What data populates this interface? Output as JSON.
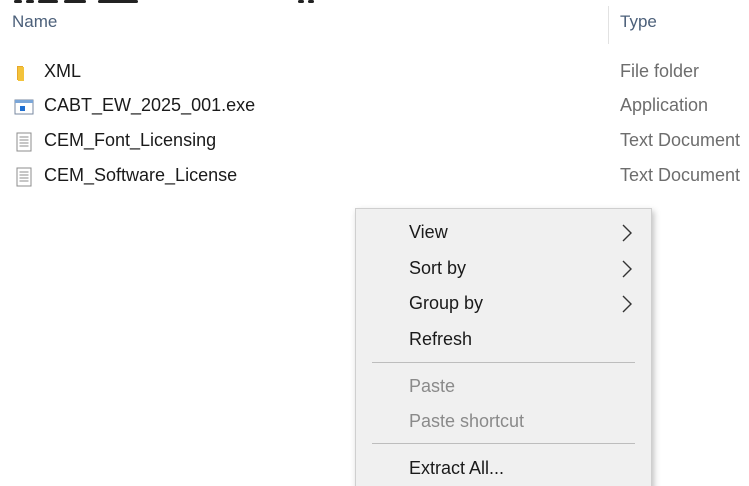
{
  "header": {
    "name_label": "Name",
    "type_label": "Type"
  },
  "files": [
    {
      "name": "XML",
      "type": "File folder",
      "icon": "folder-icon"
    },
    {
      "name": "CABT_EW_2025_001.exe",
      "type": "Application",
      "icon": "application-icon"
    },
    {
      "name": "CEM_Font_Licensing",
      "type": "Text Document",
      "icon": "text-document-icon"
    },
    {
      "name": "CEM_Software_License",
      "type": "Text Document",
      "icon": "text-document-icon"
    }
  ],
  "context_menu": {
    "items": [
      {
        "label": "View",
        "submenu": true,
        "enabled": true
      },
      {
        "label": "Sort by",
        "submenu": true,
        "enabled": true
      },
      {
        "label": "Group by",
        "submenu": true,
        "enabled": true
      },
      {
        "label": "Refresh",
        "submenu": false,
        "enabled": true
      },
      {
        "label": "Paste",
        "submenu": false,
        "enabled": false
      },
      {
        "label": "Paste shortcut",
        "submenu": false,
        "enabled": false
      },
      {
        "label": "Extract All...",
        "submenu": false,
        "enabled": true
      }
    ]
  },
  "colors": {
    "folder": "#f3c33b",
    "header_text": "#4c607a",
    "menu_background": "#f0f0f0",
    "disabled_text": "#8a8a8a"
  }
}
